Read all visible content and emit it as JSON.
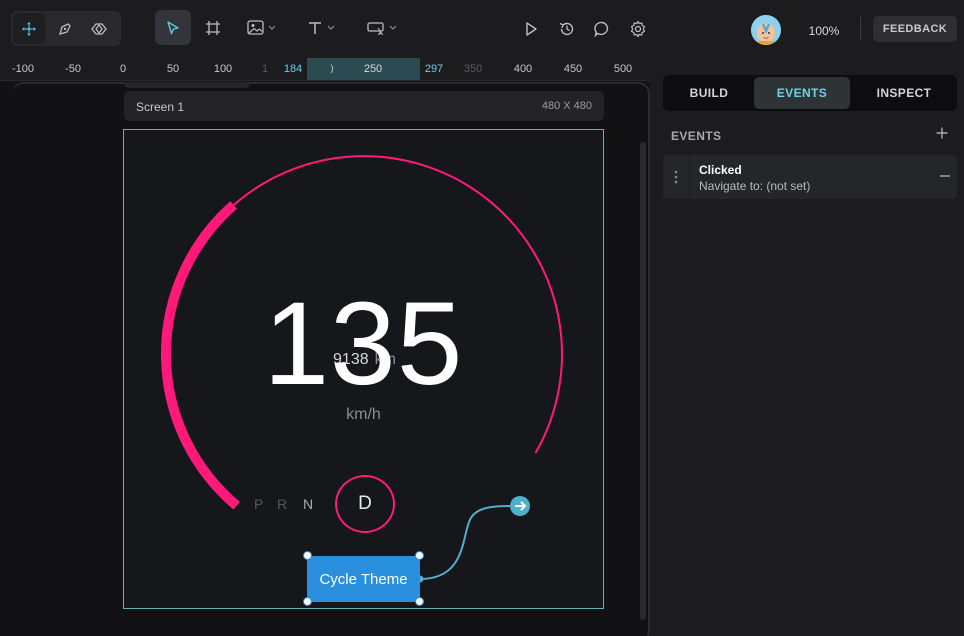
{
  "toolbar": {
    "mode_icons": [
      "move-icon",
      "pen-icon",
      "component-icon"
    ],
    "tools": [
      "select-icon",
      "frame-icon",
      "image-icon",
      "text-icon",
      "input-icon"
    ],
    "actions": [
      "play-icon",
      "history-icon",
      "comment-icon",
      "settings-icon"
    ],
    "zoom": "100%",
    "feedback_label": "FEEDBACK"
  },
  "ruler": {
    "ticks": [
      "-100",
      "-50",
      "0",
      "50",
      "100",
      "184",
      "250",
      "297",
      "350",
      "400",
      "450",
      "500"
    ]
  },
  "canvas": {
    "screen_name": "Screen 1",
    "screen_size": "480 X 480",
    "odometer_value": "9138",
    "odometer_unit": "km",
    "speed": "135",
    "speed_unit": "km/h",
    "gears": [
      "P",
      "R",
      "N",
      "D"
    ],
    "active_gear": "D",
    "speed_fraction": 0.38,
    "cycle_button_label": "Cycle Theme",
    "accent_color": "#ff1a7a",
    "selection_color": "#5fb3c4",
    "button_color": "#2a8fdc"
  },
  "panel": {
    "tabs": [
      "BUILD",
      "EVENTS",
      "INSPECT"
    ],
    "active_tab": "EVENTS",
    "events_title": "EVENTS",
    "events": [
      {
        "name": "Clicked",
        "action": "Navigate to: (not set)"
      }
    ]
  }
}
